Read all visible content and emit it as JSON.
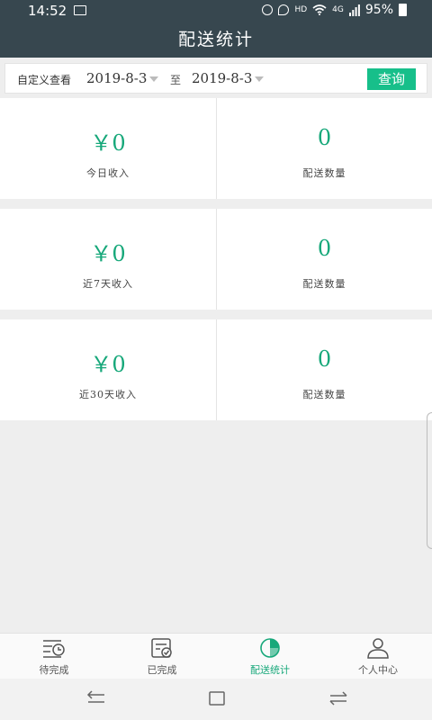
{
  "status_bar": {
    "time": "14:52",
    "network_label": "HD",
    "signal_label": "4G",
    "battery_text": "95%"
  },
  "header": {
    "title": "配送统计"
  },
  "filter": {
    "label": "自定义查看",
    "start_date": "2019-8-3",
    "to_label": "至",
    "end_date": "2019-8-3",
    "query_button": "查询"
  },
  "stats": [
    {
      "income_value": "￥0",
      "income_label": "今日收入",
      "count_value": "0",
      "count_label": "配送数量"
    },
    {
      "income_value": "￥0",
      "income_label": "近7天收入",
      "count_value": "0",
      "count_label": "配送数量"
    },
    {
      "income_value": "￥0",
      "income_label": "近30天收入",
      "count_value": "0",
      "count_label": "配送数量"
    }
  ],
  "tabbar": {
    "tabs": [
      {
        "label": "待完成",
        "icon": "clock-list-icon"
      },
      {
        "label": "已完成",
        "icon": "checked-doc-icon"
      },
      {
        "label": "配送统计",
        "icon": "pie-chart-icon",
        "active": true
      },
      {
        "label": "个人中心",
        "icon": "person-icon"
      }
    ]
  },
  "colors": {
    "header_bg": "#37474f",
    "accent": "#17bf8a",
    "value_text": "#17a87a"
  }
}
